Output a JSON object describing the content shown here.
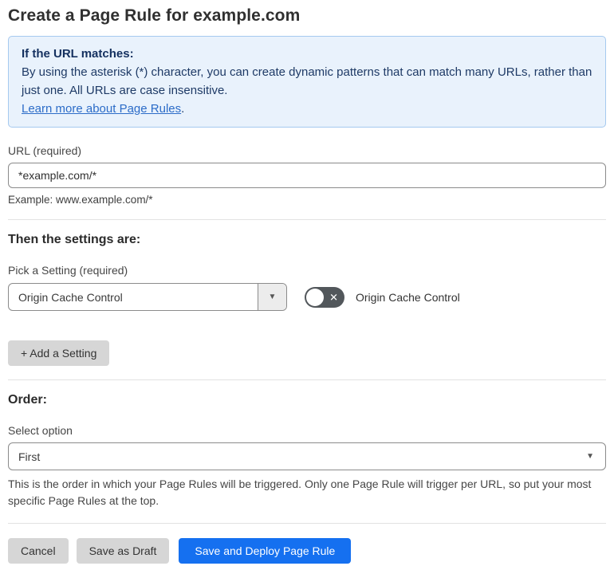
{
  "page": {
    "title": "Create a Page Rule for example.com"
  },
  "info_box": {
    "heading": "If the URL matches:",
    "body": "By using the asterisk (*) character, you can create dynamic patterns that can match many URLs, rather than just one. All URLs are case insensitive.",
    "link_label": "Learn more about Page Rules",
    "link_suffix": "."
  },
  "url_section": {
    "label": "URL (required)",
    "value": "*example.com/*",
    "helper": "Example: www.example.com/*"
  },
  "settings_section": {
    "heading": "Then the settings are:",
    "picker_label": "Pick a Setting (required)",
    "picker_value": "Origin Cache Control",
    "picker_caret": "▼",
    "toggle_state": "off",
    "toggle_glyph": "✕",
    "toggle_label": "Origin Cache Control",
    "add_button_label": "+ Add a Setting"
  },
  "order_section": {
    "heading": "Order:",
    "label": "Select option",
    "value": "First",
    "caret": "▼",
    "helper": "This is the order in which your Page Rules will be triggered. Only one Page Rule will trigger per URL, so put your most specific Page Rules at the top."
  },
  "footer": {
    "cancel_label": "Cancel",
    "save_draft_label": "Save as Draft",
    "save_deploy_label": "Save and Deploy Page Rule"
  },
  "colors": {
    "primary_button": "#1570f0",
    "info_box_background": "#e9f2fc",
    "info_box_border": "#a5c9ef",
    "info_text": "#1e3a66",
    "link": "#2c6cc8",
    "toggle_track_off": "#52575b",
    "gray_button": "#d6d6d6",
    "input_border": "#8b8b8b"
  }
}
